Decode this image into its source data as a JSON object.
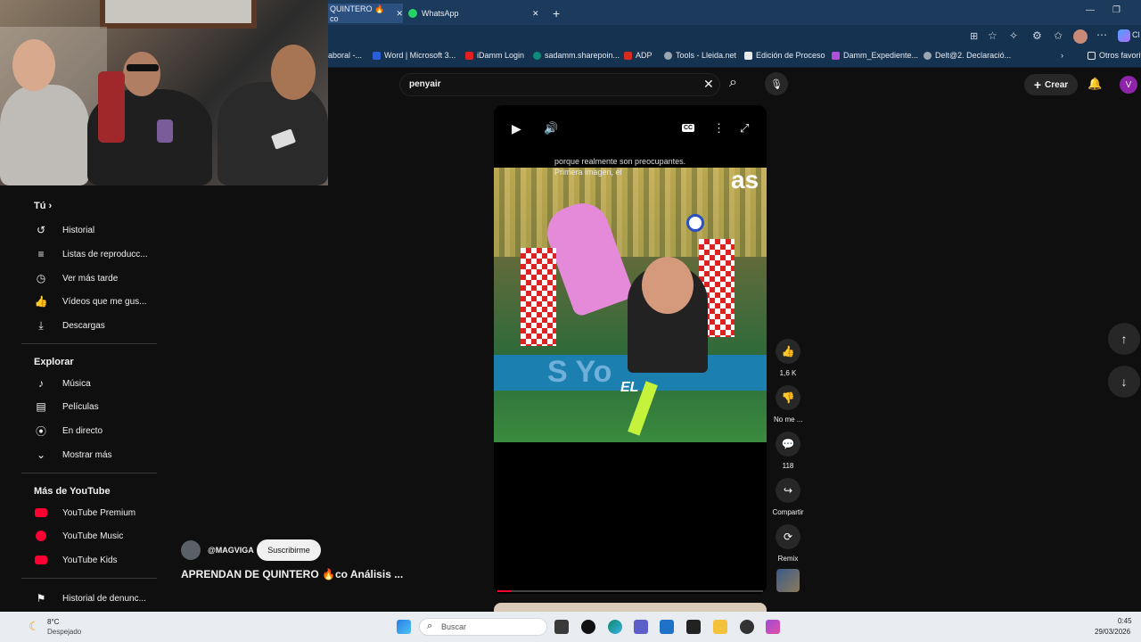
{
  "tabs": {
    "active_title": "QUINTERO 🔥co",
    "second_title": "WhatsApp",
    "close": "✕",
    "new": "+"
  },
  "window": {
    "minimize": "—",
    "restore": "❐",
    "profile": "Cl"
  },
  "bookmarks": [
    "aboral -...",
    "Word | Microsoft 3...",
    "iDamm Login",
    "sadamm.sharepoin...",
    "ADP",
    "Tools - Lleida.net",
    "Edición de Proceso",
    "Damm_Expediente...",
    "Delt@2. Declaració...",
    "Otros favorit"
  ],
  "youtube": {
    "search_value": "penyair",
    "create_label": "Crear",
    "avatar_letter": "V",
    "sidebar": {
      "you_title": "Tú",
      "you_items": [
        "Historial",
        "Listas de reproducc...",
        "Ver más tarde",
        "Vídeos que me gus...",
        "Descargas"
      ],
      "explore_title": "Explorar",
      "explore_items": [
        "Música",
        "Películas",
        "En directo",
        "Mostrar más"
      ],
      "more_title": "Más de YouTube",
      "more_items": [
        "YouTube Premium",
        "YouTube Music",
        "YouTube Kids"
      ],
      "report": "Historial de denunc..."
    },
    "short": {
      "caption_line1": "porque realmente son preocupantes.",
      "caption_line2": "Primera imagen, el",
      "logo_text": "as",
      "overlay_word": "EL",
      "channel": "@MAGVIGA",
      "subscribe": "Suscribirme",
      "title": "APRENDAN DE QUINTERO 🔥co Análisis ...",
      "likes": "1,6 K",
      "dislike_label": "No me ...",
      "comments": "118",
      "share": "Compartir",
      "remix": "Remix",
      "progress": 0.05,
      "cc_label": "CC"
    }
  },
  "taskbar": {
    "weather_temp": "8°C",
    "weather_desc": "Despejado",
    "search_placeholder": "Buscar",
    "time": "0:45",
    "date": "29/03/2026"
  },
  "colors": {
    "tabbar": "#1b3a5c",
    "youtube_red": "#ff0033",
    "taskbar": "#e9edf2"
  }
}
